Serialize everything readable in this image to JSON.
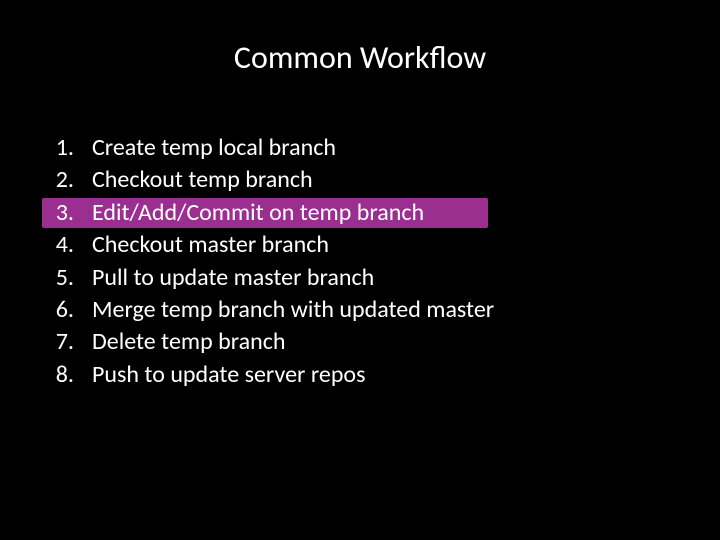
{
  "title": "Common Workflow",
  "items": [
    {
      "n": "1.",
      "text": "Create temp local branch",
      "highlight": false
    },
    {
      "n": "2.",
      "text": "Checkout temp branch",
      "highlight": false
    },
    {
      "n": "3.",
      "text": "Edit/Add/Commit on temp branch",
      "highlight": true
    },
    {
      "n": "4.",
      "text": "Checkout master branch",
      "highlight": false
    },
    {
      "n": "5.",
      "text": "Pull to update master branch",
      "highlight": false
    },
    {
      "n": "6.",
      "text": "Merge temp branch with updated master",
      "highlight": false
    },
    {
      "n": "7.",
      "text": "Delete temp branch",
      "highlight": false
    },
    {
      "n": "8.",
      "text": "Push to update server repos",
      "highlight": false
    }
  ]
}
